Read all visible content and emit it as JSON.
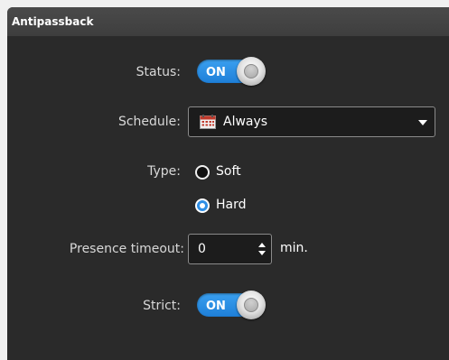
{
  "panel": {
    "title": "Antipassback"
  },
  "status": {
    "label": "Status:",
    "toggle_text": "ON"
  },
  "schedule": {
    "label": "Schedule:",
    "value": "Always",
    "icon": "calendar-icon"
  },
  "type": {
    "label": "Type:",
    "options": [
      {
        "label": "Soft",
        "selected": false
      },
      {
        "label": "Hard",
        "selected": true
      }
    ]
  },
  "presence_timeout": {
    "label": "Presence timeout:",
    "value": "0",
    "unit": "min."
  },
  "strict": {
    "label": "Strict:",
    "toggle_text": "ON"
  },
  "colors": {
    "accent": "#2f8fe6",
    "panel_bg": "#2a2a2a",
    "header_bg": "#444444"
  }
}
